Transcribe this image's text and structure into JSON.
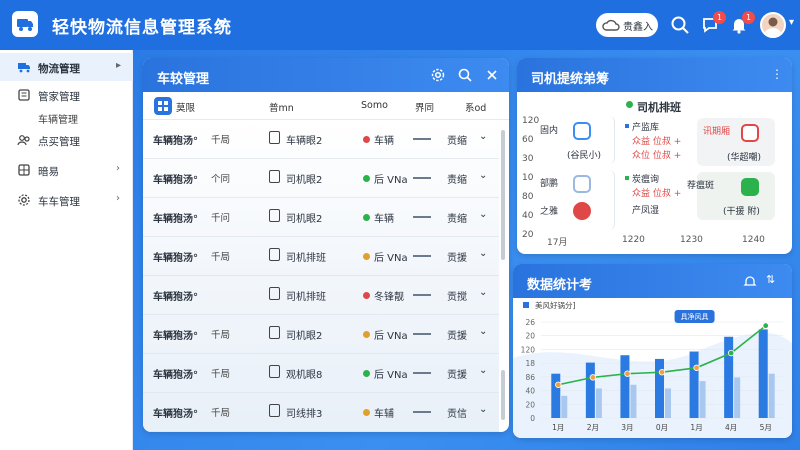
{
  "header": {
    "app_title": "轻快物流信息管理系统",
    "cloud_label": "贵鑫入",
    "msg_badge": "1",
    "bell_badge": "1"
  },
  "sidebar": {
    "items": [
      {
        "label": "物流管理",
        "icon": "truck-icon"
      },
      {
        "label": "管家管理",
        "icon": "list-icon"
      },
      {
        "label": "车辆管理",
        "icon": ""
      },
      {
        "label": "点买管理",
        "icon": "users-icon"
      },
      {
        "label": "暗易",
        "icon": "grid-icon"
      },
      {
        "label": "车车管理",
        "icon": "gear-icon"
      }
    ]
  },
  "vehicle_panel": {
    "title": "车较管理",
    "columns": [
      "莫限",
      "普mn",
      "Somo",
      "界同",
      "系od"
    ],
    "rows": [
      {
        "c1": "车辆狍汤°",
        "c2": "千局",
        "c3": "车辆眼2",
        "status": "车辆",
        "dot": "#e04848",
        "c5": "贡缩"
      },
      {
        "c1": "车辆狍汤°",
        "c2": "个同",
        "c3": "司机眼2",
        "status": "后 VNa",
        "dot": "#2bb24c",
        "c5": "责缩"
      },
      {
        "c1": "车辆狍汤°",
        "c2": "千问",
        "c3": "司机眼2",
        "status": "车辆",
        "dot": "#2bb24c",
        "c5": "责缩"
      },
      {
        "c1": "车辆狍汤°",
        "c2": "千局",
        "c3": "司机排班",
        "status": "后 VNa",
        "dot": "#e0a030",
        "c5": "贡援"
      },
      {
        "c1": "车辆狍汤°",
        "c2": "",
        "c3": "司机排班",
        "status": "冬锋靓",
        "dot": "#e04848",
        "c5": "贡搅"
      },
      {
        "c1": "车辆狍汤°",
        "c2": "千局",
        "c3": "司机眼2",
        "status": "后 VNa",
        "dot": "#e0a030",
        "c5": "贡援"
      },
      {
        "c1": "车辆狍汤°",
        "c2": "千局",
        "c3": "观机眼8",
        "status": "后 VNa",
        "dot": "#2bb24c",
        "c5": "贡援"
      },
      {
        "c1": "车辆狍汤°",
        "c2": "千局",
        "c3": "司线排3",
        "status": "车辅",
        "dot": "#e0a030",
        "c5": "贡信"
      }
    ]
  },
  "driver_panel": {
    "title": "司机提统弟筹",
    "subtitle": "司机排班",
    "y_ticks": [
      "120",
      "60",
      "30",
      "10",
      "80",
      "40",
      "20"
    ],
    "x_ticks": [
      "17月",
      "1220",
      "1230",
      "1240"
    ],
    "left_labels": [
      "固内",
      "部鹏",
      "之雅"
    ],
    "left_sub": "(谷民小)",
    "mid_top": {
      "l1": "产监库",
      "l2": "众益 位叔 +",
      "l3": "众位 位叔 +"
    },
    "mid_bottom": {
      "l1": "炭瘟询",
      "l2": "众益 位叔 +",
      "l3": "产凤湿"
    },
    "right_top": {
      "label": "(华超嘲)",
      "head": "讯期厢"
    },
    "right_bottom": {
      "label": "(干援 附)",
      "head": "荐瘟斑"
    },
    "accent": "#2bb24c"
  },
  "stats_panel": {
    "title": "数据统计考",
    "legend": "美风好锅分]",
    "tooltip": "具净风具",
    "chart_data": {
      "type": "bar",
      "categories": [
        "1月",
        "2月",
        "3月",
        "0月",
        "1月",
        "4月",
        "5月"
      ],
      "series": [
        {
          "values": [
            60,
            75,
            85,
            80,
            90,
            110,
            120
          ]
        },
        {
          "values": [
            30,
            40,
            45,
            40,
            50,
            55,
            60
          ]
        },
        {
          "values": [
            45,
            55,
            60,
            62,
            68,
            88,
            125
          ]
        }
      ],
      "ylim": [
        0,
        130
      ],
      "y_ticks": [
        "26",
        "20",
        "120",
        "18",
        "86",
        "40",
        "20",
        "0"
      ]
    }
  }
}
